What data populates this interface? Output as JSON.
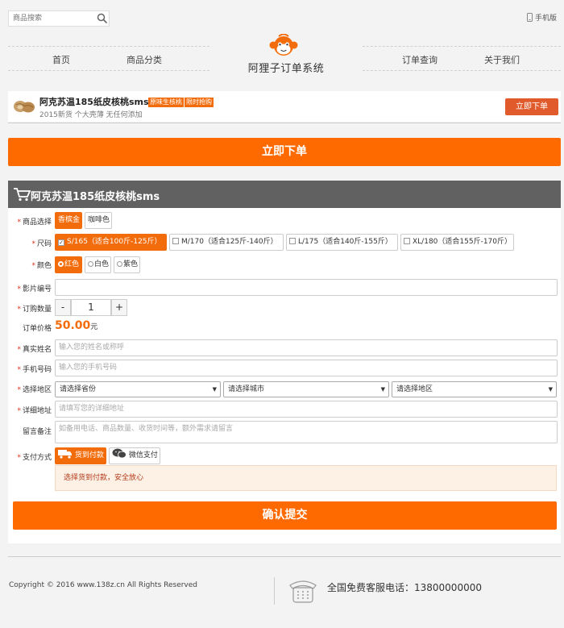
{
  "header": {
    "search_placeholder": "商品搜索",
    "mobile_label": "手机版",
    "site_title": "阿狸子订单系统",
    "nav": [
      "首页",
      "商品分类",
      "订单查询",
      "关于我们"
    ]
  },
  "product_strip": {
    "name": "阿克苏温185纸皮核桃sms",
    "tags": [
      "原味生核桃",
      "限时抢购"
    ],
    "subtitle": "2015新货 个大壳薄 无任何添加",
    "buy_label": "立即下单"
  },
  "order_button_label": "立即下单",
  "form": {
    "title": "阿克苏温185纸皮核桃sms",
    "labels": {
      "product": "商品选择",
      "size": "尺码",
      "color": "颜色",
      "film_no": "影片编号",
      "quantity": "订购数量",
      "price": "订单价格",
      "name": "真实姓名",
      "phone": "手机号码",
      "region": "选择地区",
      "address": "详细地址",
      "message": "留言备注",
      "payment": "支付方式"
    },
    "product_options": [
      {
        "label": "香槟金",
        "selected": true
      },
      {
        "label": "咖啡色",
        "selected": false
      }
    ],
    "size_options": [
      {
        "label": "S/165（适合100斤-125斤）",
        "selected": true
      },
      {
        "label": "M/170（适合125斤-140斤）",
        "selected": false
      },
      {
        "label": "L/175（适合140斤-155斤）",
        "selected": false
      },
      {
        "label": "XL/180（适合155斤-170斤）",
        "selected": false
      }
    ],
    "color_options": [
      {
        "label": "红色",
        "selected": true
      },
      {
        "label": "白色",
        "selected": false
      },
      {
        "label": "紫色",
        "selected": false
      }
    ],
    "quantity": "1",
    "quantity_minus": "-",
    "quantity_plus": "+",
    "price_value": "50.00",
    "price_unit": "元",
    "name_placeholder": "输入您的姓名或称呼",
    "phone_placeholder": "输入您的手机号码",
    "province_placeholder": "请选择省份",
    "city_placeholder": "请选择城市",
    "district_placeholder": "请选择地区",
    "address_placeholder": "请填写您的详细地址",
    "message_placeholder": "如备用电话、商品数量、收货时间等，额外需求请留言",
    "payment_options": [
      {
        "label": "货到付款",
        "icon": "truck-icon",
        "selected": true
      },
      {
        "label": "微信支付",
        "icon": "wechat-icon",
        "selected": false
      }
    ],
    "payment_notice": "选择货到付款，安全放心",
    "submit_label": "确认提交"
  },
  "footer": {
    "copyright": "Copyright © 2016 www.138z.cn All Rights Reserved",
    "hotline": "全国免费客服电话：13800000000"
  },
  "colors": {
    "accent": "#ff6a00",
    "header_bar": "#616161",
    "buy_small": "#e05a2c"
  }
}
